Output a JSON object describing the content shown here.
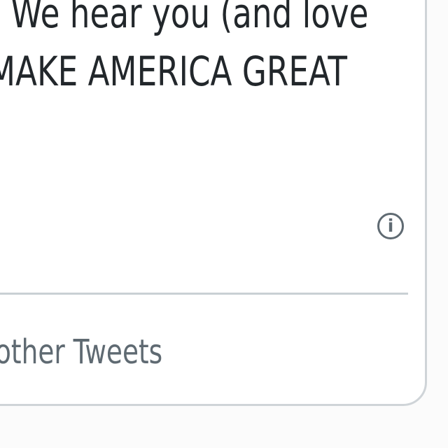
{
  "tweet": {
    "text_line_1": "! We hear you (and love",
    "text_line_2": "MAKE AMERICA GREAT"
  },
  "actions": {
    "info_icon_glyph": "i",
    "info_icon_name": "info-icon",
    "more_tweets_label": "other Tweets"
  },
  "colors": {
    "card_border": "#cfd4d8",
    "tweet_text": "#22272b",
    "secondary_text": "#5f6a72",
    "divider": "#c9d0d4"
  }
}
